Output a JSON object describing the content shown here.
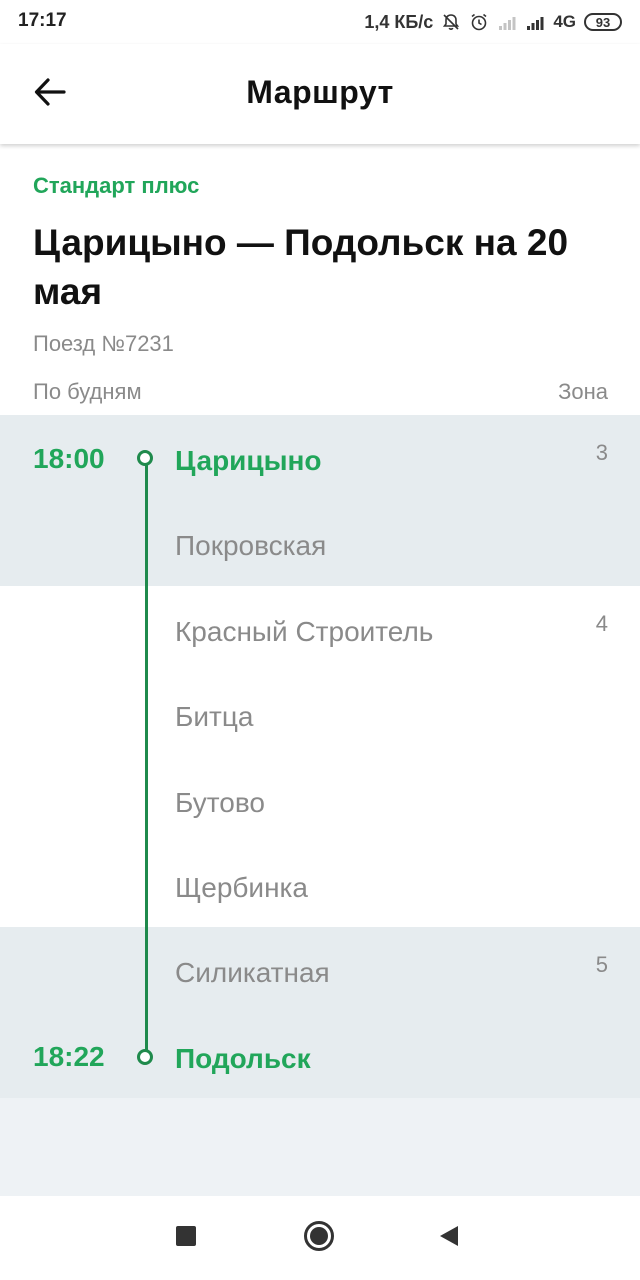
{
  "status_bar": {
    "time": "17:17",
    "speed": "1,4 КБ/с",
    "network": "4G",
    "battery": "93",
    "icons": [
      "notifications-off-icon",
      "alarm-icon",
      "signal-weak-icon",
      "signal-full-icon",
      "battery-icon"
    ]
  },
  "app_bar": {
    "title": "Маршрут",
    "back_icon": "arrow-left-icon"
  },
  "header": {
    "fare_type": "Стандарт плюс",
    "route_title": "Царицыно — Подольск на 20 мая",
    "train_number": "Поезд №7231",
    "schedule_days": "По будням",
    "zone_header": "Зона"
  },
  "stops": [
    {
      "time": "18:00",
      "name": "Царицыно",
      "zone": "3",
      "terminal": true
    },
    {
      "time": "",
      "name": "Покровская",
      "zone": "",
      "terminal": false
    },
    {
      "time": "",
      "name": "Красный Строитель",
      "zone": "4",
      "terminal": false
    },
    {
      "time": "",
      "name": "Битца",
      "zone": "",
      "terminal": false
    },
    {
      "time": "",
      "name": "Бутово",
      "zone": "",
      "terminal": false
    },
    {
      "time": "",
      "name": "Щербинка",
      "zone": "",
      "terminal": false
    },
    {
      "time": "",
      "name": "Силикатная",
      "zone": "5",
      "terminal": false
    },
    {
      "time": "18:22",
      "name": "Подольск",
      "zone": "",
      "terminal": true
    }
  ],
  "colors": {
    "accent_green": "#21a65a",
    "route_line": "#1f8a4c",
    "zone_shade": "#e6ecef",
    "muted_text": "#8a8a8a"
  },
  "nav_bar": {
    "icons": [
      "recent-apps-icon",
      "home-icon",
      "back-icon"
    ]
  }
}
